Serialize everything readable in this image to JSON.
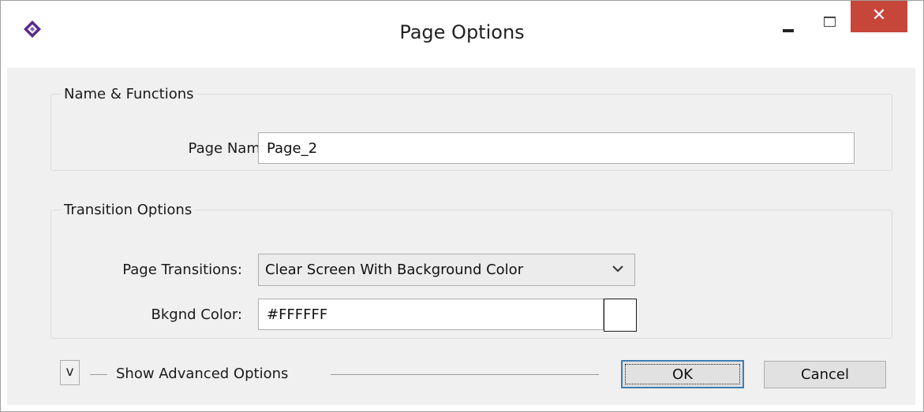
{
  "window": {
    "title": "Page Options",
    "close_glyph": "✕"
  },
  "name_functions": {
    "legend": "Name & Functions",
    "page_name_label": "Page Name:",
    "page_name_value": "Page_2"
  },
  "transition_options": {
    "legend": "Transition Options",
    "page_transitions_label": "Page Transitions:",
    "page_transitions_value": "Clear Screen With Background Color",
    "bkgnd_color_label": "Bkgnd Color:",
    "bkgnd_color_value": "#FFFFFF",
    "swatch_color": "#FFFFFF"
  },
  "footer": {
    "toggle_label": "v",
    "advanced_label": "Show Advanced Options",
    "ok_label": "OK",
    "cancel_label": "Cancel"
  },
  "colors": {
    "close_button": "#c7463a",
    "app_icon": "#5b2a86",
    "client_bg": "#f0f0f0"
  },
  "icons": {
    "app": "diamond-logo-icon",
    "minimize": "minimize-icon",
    "maximize": "maximize-icon",
    "close": "close-icon",
    "dropdown": "chevron-down-icon"
  }
}
